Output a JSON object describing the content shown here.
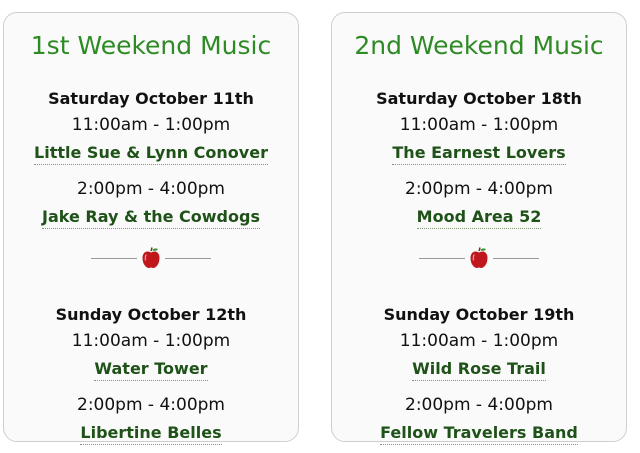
{
  "weekends": [
    {
      "title": "1st Weekend Music",
      "days": [
        {
          "day": "Saturday October 11th",
          "sets": [
            {
              "time": "11:00am - 1:00pm",
              "band": "Little Sue & Lynn Conover"
            },
            {
              "time": "2:00pm - 4:00pm",
              "band": "Jake Ray & the Cowdogs"
            }
          ]
        },
        {
          "day": "Sunday October 12th",
          "sets": [
            {
              "time": "11:00am - 1:00pm",
              "band": "Water Tower"
            },
            {
              "time": "2:00pm - 4:00pm",
              "band": "Libertine Belles"
            }
          ]
        }
      ]
    },
    {
      "title": "2nd Weekend Music",
      "days": [
        {
          "day": "Saturday October 18th",
          "sets": [
            {
              "time": "11:00am - 1:00pm",
              "band": "The Earnest Lovers"
            },
            {
              "time": "2:00pm - 4:00pm",
              "band": "Mood Area 52"
            }
          ]
        },
        {
          "day": "Sunday October 19th",
          "sets": [
            {
              "time": "11:00am - 1:00pm",
              "band": "Wild Rose Trail"
            },
            {
              "time": "2:00pm - 4:00pm",
              "band": "Fellow Travelers Band"
            }
          ]
        }
      ]
    }
  ],
  "colors": {
    "title_green": "#2e8a24",
    "band_green": "#1f5218",
    "apple_red": "#c0171c"
  },
  "divider_icon": "apple-icon"
}
